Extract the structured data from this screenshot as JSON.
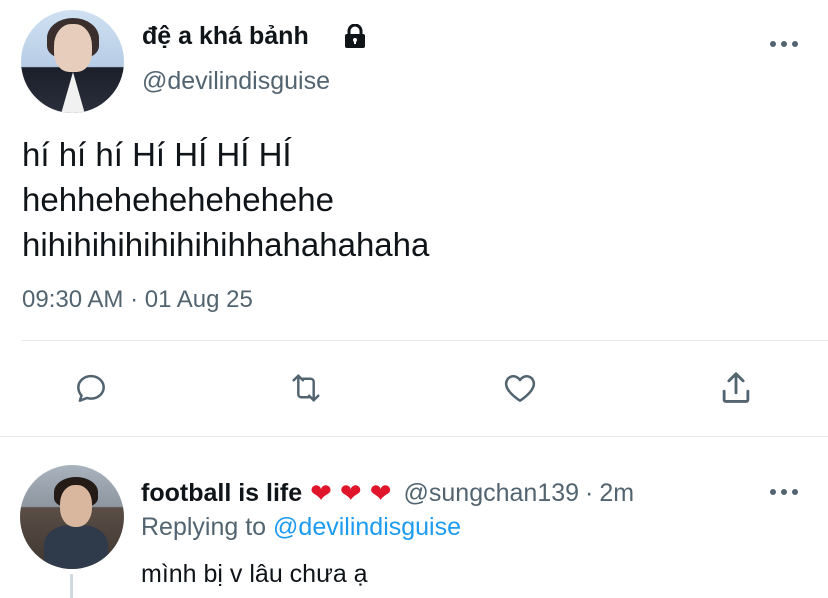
{
  "tweet": {
    "display_name": "đệ a khá bảnh",
    "handle": "@devilindisguise",
    "text_lines": [
      "hí hí hí Hí HÍ HÍ HÍ",
      "hehhehehehehehehe",
      "hihihihihihihihihhahahahaha"
    ],
    "timestamp": "09:30 AM · 01 Aug 25",
    "icons": {
      "lock": "lock-icon",
      "more": "more-icon",
      "reply": "reply-icon",
      "retweet": "retweet-icon",
      "like": "like-icon",
      "share": "share-icon"
    }
  },
  "reply": {
    "display_name": "football is life",
    "emoji": [
      "❤",
      "❤",
      "❤"
    ],
    "handle": "@sungchan139",
    "separator": "·",
    "time": "2m",
    "replying_prefix": "Replying to ",
    "replying_to": "@devilindisguise",
    "text": "mình bị v lâu chưa ạ"
  },
  "colors": {
    "text_primary": "#0f1419",
    "text_secondary": "#536471",
    "accent": "#1d9bf0",
    "heart": "#e0142a",
    "divider": "#e6e9eb"
  }
}
